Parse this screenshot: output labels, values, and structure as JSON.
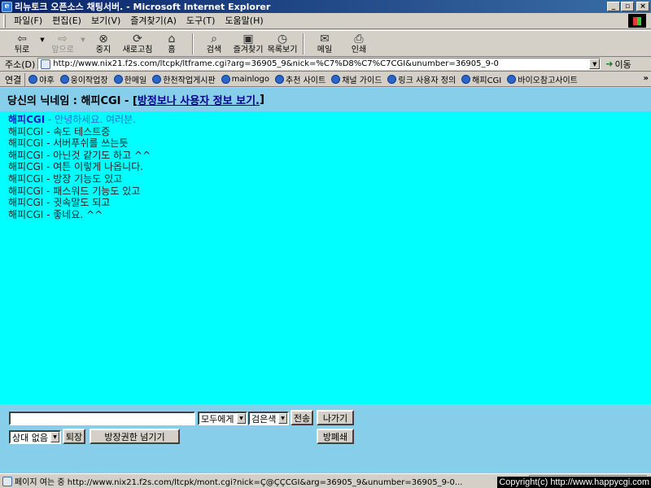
{
  "window": {
    "title": "리뉴토크 오픈소스 채팅서버. - Microsoft Internet Explorer",
    "controls": [
      "_",
      "▫",
      "×"
    ]
  },
  "menu": [
    "파일(F)",
    "편집(E)",
    "보기(V)",
    "즐겨찾기(A)",
    "도구(T)",
    "도움말(H)"
  ],
  "toolbar": {
    "back": "뒤로",
    "forward": "앞으로",
    "stop": "중지",
    "refresh": "새로고침",
    "home": "홈",
    "search": "검색",
    "favorites": "즐겨찾기",
    "history": "목록보기",
    "mail": "메일",
    "print": "인쇄"
  },
  "address": {
    "label": "주소(D)",
    "url": "http://www.nix21.f2s.com/ltcpk/ltframe.cgi?arg=36905_9&nick=%C7%D8%C7%C7CGI&unumber=36905_9-0",
    "go": "이동"
  },
  "links": {
    "label": "연결",
    "items": [
      "야후",
      "웅이작업장",
      "한메일",
      "한천작업게시판",
      "mainlogo",
      "추천 사이트",
      "채널 가이드",
      "링크 사용자 정의",
      "해피CGI",
      "바이오참고사이트"
    ],
    "more": "»"
  },
  "chat": {
    "header_prefix": "당신의 닉네임 : 해피CGI - [",
    "header_link": "방정보나 사용자 정보 보기.",
    "header_suffix": "]",
    "messages": [
      {
        "nick": "해피CGI",
        "text": " - 안녕하세요. 여러분."
      },
      {
        "nick": "해피CGI",
        "text": " - 속도 테스트중"
      },
      {
        "nick": "해피CGI",
        "text": " - 서버푸쉬를 쓰는듯"
      },
      {
        "nick": "해피CGI",
        "text": " - 아닌것 같기도 하고 ^^"
      },
      {
        "nick": "해피CGI",
        "text": " - 여튼 이렇게 나옵니다."
      },
      {
        "nick": "해피CGI",
        "text": " - 방장 기능도 있고"
      },
      {
        "nick": "해피CGI",
        "text": " - 패스워드 기능도 있고"
      },
      {
        "nick": "해피CGI",
        "text": " - 귓속말도 되고"
      },
      {
        "nick": "해피CGI",
        "text": " - 좋네요. ^^"
      }
    ]
  },
  "input": {
    "message_value": "",
    "target_select": "모두에게",
    "color_select": "검은색",
    "send": "전송",
    "exit": "나가기",
    "user_select": "상대 없음",
    "kick": "퇴장",
    "pass_owner": "방장권한 넘기기",
    "close_room": "방폐쇄"
  },
  "status": {
    "text": "페이지 여는 중 http://www.nix21.f2s.com/ltcpk/mont.cgi?nick=Ç@ÇÇCGI&arg=36905_9&unumber=36905_9-0...",
    "copyright": "Copyright(c) http://www.happycgi.com"
  },
  "colors": {
    "titlebar_start": "#0a246a",
    "titlebar_end": "#3a6ea5",
    "chat_header_bg": "#87ceeb",
    "chat_bg": "#00ffff",
    "first_nick": "#1a1acb",
    "first_text": "#2a6ee8"
  }
}
